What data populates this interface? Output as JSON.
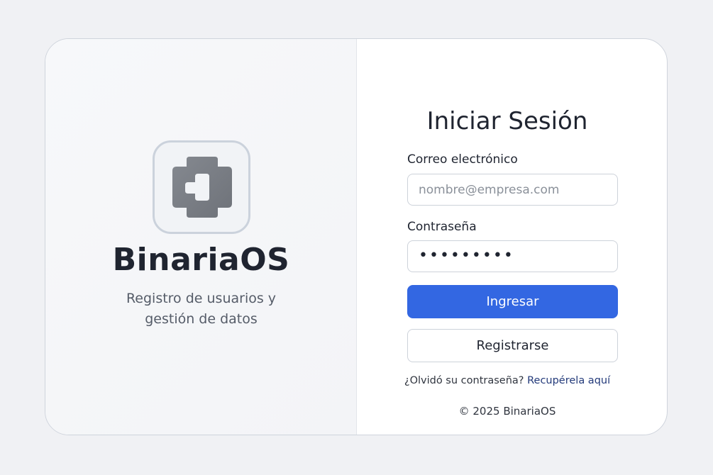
{
  "brand": {
    "name": "BinariaOS",
    "tagline_line1": "Registro de usuarios y",
    "tagline_line2": "gestión de datos",
    "logo_icon": "binaria-logo-icon"
  },
  "login": {
    "title": "Iniciar Sesión",
    "email_label": "Correo electrónico",
    "email_placeholder": "nombre@empresa.com",
    "email_value": "",
    "password_label": "Contraseña",
    "password_value": "•••••••••",
    "submit_label": "Ingresar",
    "register_label": "Registrarse",
    "forgot_text": "¿Olvidó su contraseña?",
    "recover_link": "Recupérela aquí",
    "copyright": "© 2025 BinariaOS"
  },
  "colors": {
    "primary": "#3367e2",
    "background": "#f0f1f4",
    "text": "#1f2430",
    "link": "#233a7a",
    "logo": "#7b7f86"
  }
}
